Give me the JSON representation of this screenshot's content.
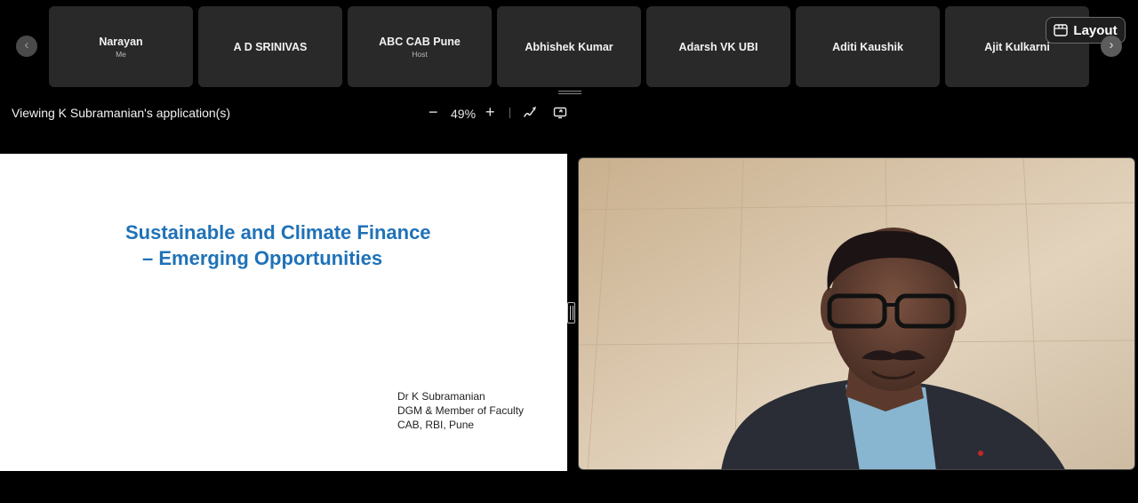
{
  "participants": [
    {
      "name": "Narayan",
      "sub": "Me"
    },
    {
      "name": "A D SRINIVAS",
      "sub": ""
    },
    {
      "name": "ABC CAB Pune",
      "sub": "Host"
    },
    {
      "name": "Abhishek Kumar",
      "sub": ""
    },
    {
      "name": "Adarsh VK UBI",
      "sub": ""
    },
    {
      "name": "Aditi Kaushik",
      "sub": ""
    },
    {
      "name": "Ajit Kulkarni",
      "sub": ""
    }
  ],
  "nav": {
    "prev_icon": "chevron-left-icon",
    "next_icon": "chevron-right-icon"
  },
  "layout_button": {
    "label": "Layout",
    "icon": "layout-icon"
  },
  "share": {
    "title": "Viewing K Subramanian's application(s)",
    "zoom": "49%",
    "zoom_out_glyph": "−",
    "zoom_in_glyph": "+"
  },
  "slide": {
    "title_line1": "Sustainable and Climate Finance",
    "title_line2": "– Emerging Opportunities",
    "author_lines": [
      "Dr K Subramanian",
      "DGM & Member of Faculty",
      "CAB, RBI, Pune"
    ]
  },
  "colors": {
    "slide_title": "#1f72b8",
    "tile_bg": "#292929",
    "background": "#000000"
  }
}
